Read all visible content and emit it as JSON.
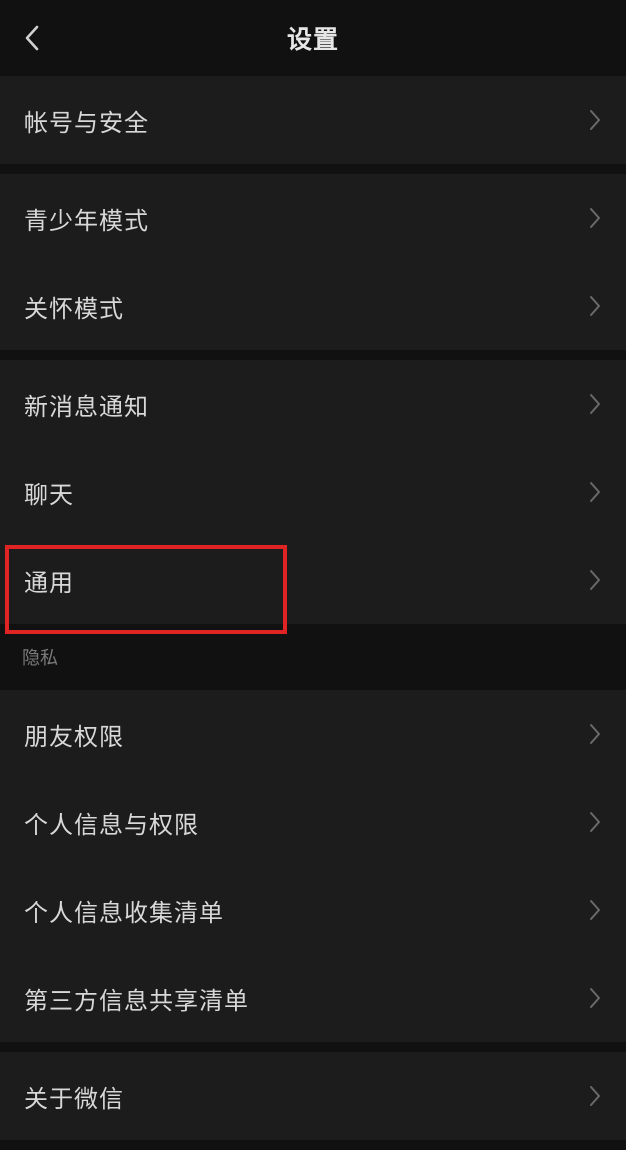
{
  "header": {
    "title": "设置",
    "back_icon": "chevron-left-icon"
  },
  "groups": [
    {
      "items": [
        {
          "label": "帐号与安全"
        }
      ]
    },
    {
      "items": [
        {
          "label": "青少年模式"
        },
        {
          "label": "关怀模式"
        }
      ]
    },
    {
      "items": [
        {
          "label": "新消息通知"
        },
        {
          "label": "聊天"
        },
        {
          "label": "通用"
        }
      ]
    }
  ],
  "privacy": {
    "header": "隐私",
    "items": [
      {
        "label": "朋友权限"
      },
      {
        "label": "个人信息与权限"
      },
      {
        "label": "个人信息收集清单"
      },
      {
        "label": "第三方信息共享清单"
      }
    ]
  },
  "about": {
    "items": [
      {
        "label": "关于微信"
      }
    ]
  },
  "colors": {
    "background": "#111111",
    "row_background": "#1c1c1c",
    "text": "#d8d8d8",
    "section_text": "#7a7a7a",
    "highlight": "#e02424"
  }
}
